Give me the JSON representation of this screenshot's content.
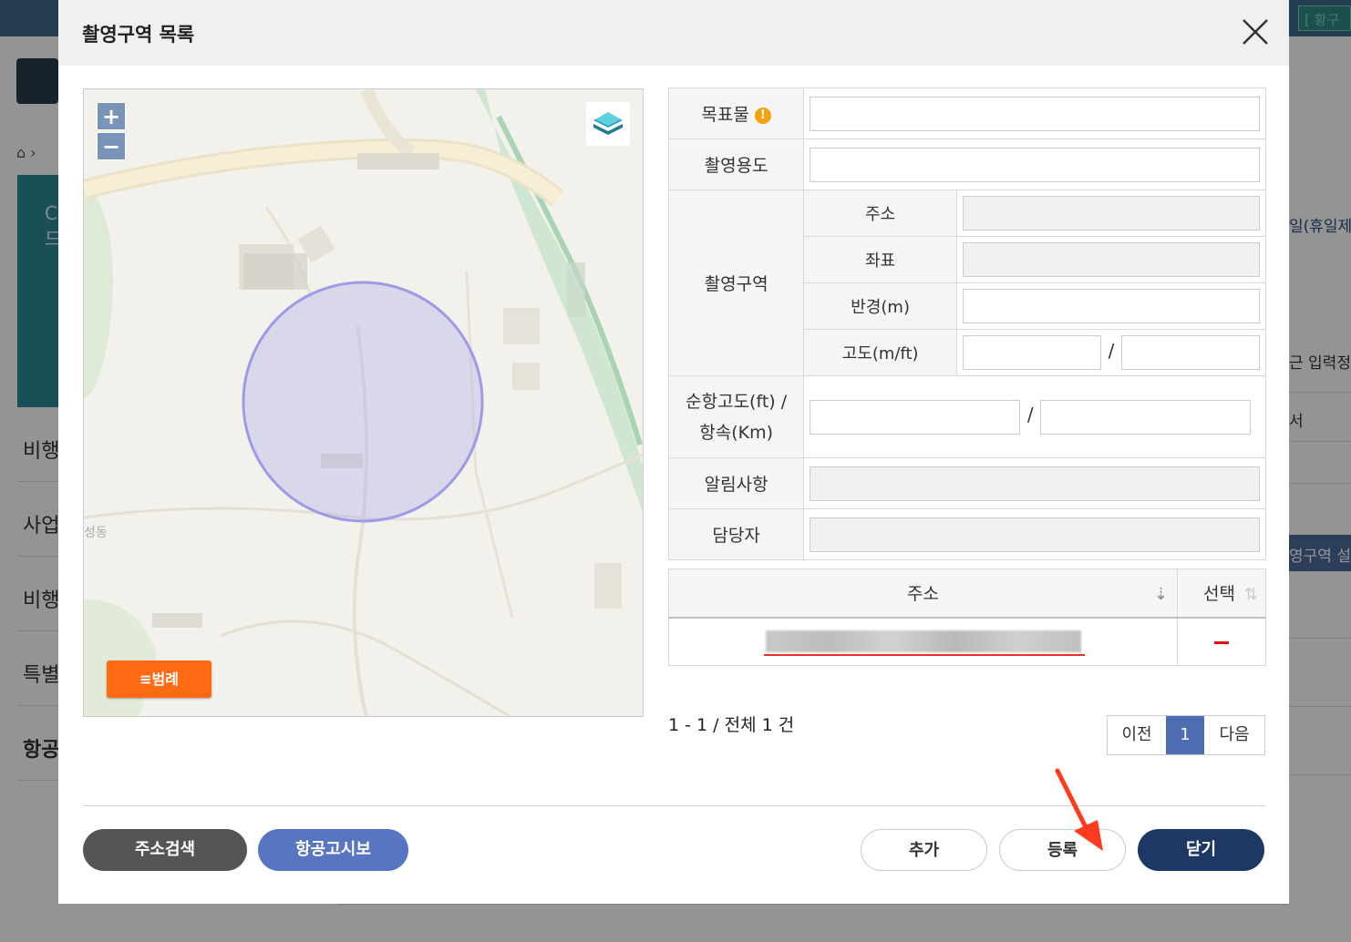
{
  "background": {
    "top_button": "[ 황구",
    "side_menu": [
      "비행",
      "사업",
      "비행",
      "특별",
      "항공"
    ],
    "right_texts": [
      "일(휴일제",
      "근 입력정",
      "서"
    ],
    "right_bar": "영구역 설"
  },
  "modal": {
    "title": "촬영구역 목록",
    "map": {
      "zoom_in": "+",
      "zoom_out": "−",
      "legend_button": "≡범례",
      "place_label": "성동"
    },
    "form": {
      "target_label": "목표물",
      "target_warning": "!",
      "purpose_label": "촬영용도",
      "area_label": "촬영구역",
      "address_label": "주소",
      "coord_label": "좌표",
      "radius_label": "반경(m)",
      "altitude_label": "고도(m/ft)",
      "altitude_sep": "/",
      "cruise_label_1": "순항고도(ft) /",
      "cruise_label_2": "항속(Km)",
      "cruise_sep": "/",
      "notice_label": "알림사항",
      "manager_label": "담당자"
    },
    "list": {
      "col_address": "주소",
      "col_select": "선택"
    },
    "count_text": "1 - 1 / 전체 1 건",
    "pager": {
      "prev": "이전",
      "current": "1",
      "next": "다음"
    },
    "buttons": {
      "address_search": "주소검색",
      "notam": "항공고시보",
      "add": "추가",
      "register": "등록",
      "close": "닫기"
    }
  }
}
